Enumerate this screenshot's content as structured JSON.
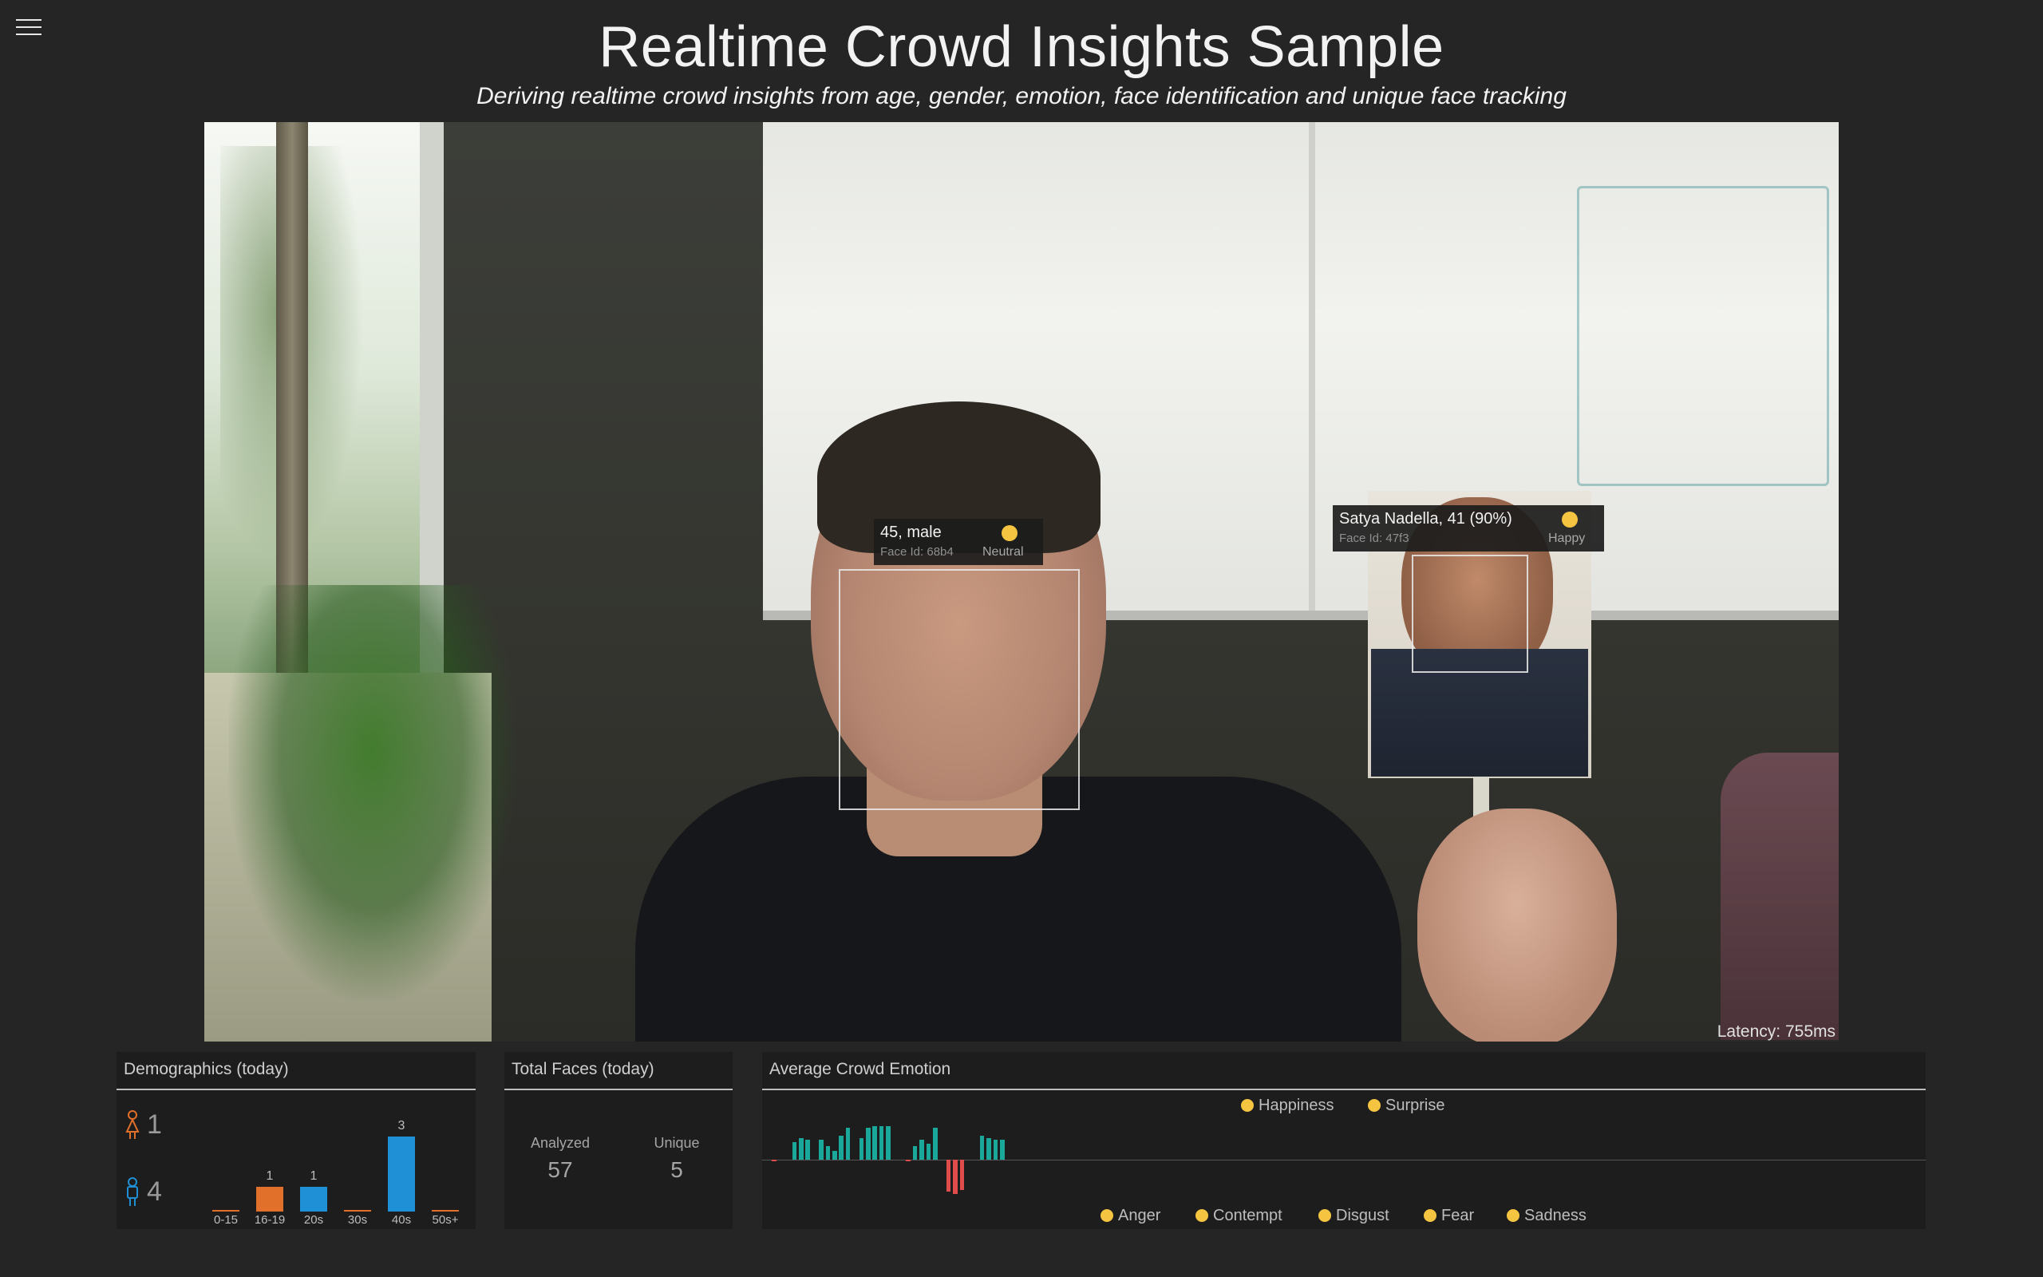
{
  "header": {
    "title": "Realtime Crowd Insights Sample",
    "subtitle": "Deriving realtime crowd insights from age, gender, emotion, face identification and unique face tracking"
  },
  "camera": {
    "latency": "Latency: 755ms",
    "faces": [
      {
        "main": "45, male",
        "sub": "Face Id: 68b4",
        "emotion": "Neutral"
      },
      {
        "main": "Satya Nadella, 41 (90%)",
        "sub": "Face Id: 47f3",
        "emotion": "Happy"
      }
    ]
  },
  "demographics": {
    "title": "Demographics (today)",
    "female_count": "1",
    "male_count": "4",
    "female_color": "#e0702a",
    "male_color": "#1f8fd6",
    "chart_data": {
      "type": "bar",
      "categories": [
        "0-15",
        "16-19",
        "20s",
        "30s",
        "40s",
        "50s+"
      ],
      "values": [
        0,
        1,
        1,
        0,
        3,
        0
      ],
      "value_labels": [
        "",
        "1",
        "1",
        "",
        "3",
        ""
      ],
      "ylim": [
        0,
        3
      ]
    }
  },
  "total_faces": {
    "title": "Total Faces (today)",
    "analyzed_label": "Analyzed",
    "analyzed_value": "57",
    "unique_label": "Unique",
    "unique_value": "5"
  },
  "emotion": {
    "title": "Average Crowd Emotion",
    "positive_color": "#1aa89a",
    "negative_color": "#e04b4b",
    "positive_legend": [
      "Happiness",
      "Surprise"
    ],
    "negative_legend": [
      "Anger",
      "Contempt",
      "Disgust",
      "Fear",
      "Sadness"
    ],
    "chart_data": {
      "type": "bar",
      "values": [
        0,
        -0.02,
        0,
        0,
        0.45,
        0.55,
        0.5,
        0,
        0.5,
        0.35,
        0.22,
        0.6,
        0.8,
        0,
        0.55,
        0.8,
        0.85,
        0.85,
        0.85,
        0,
        0,
        -0.02,
        0.35,
        0.5,
        0.4,
        0.8,
        0,
        -0.8,
        -0.85,
        -0.75,
        0,
        0,
        0.6,
        0.55,
        0.5,
        0.5
      ],
      "ylim": [
        -1,
        1
      ]
    }
  }
}
